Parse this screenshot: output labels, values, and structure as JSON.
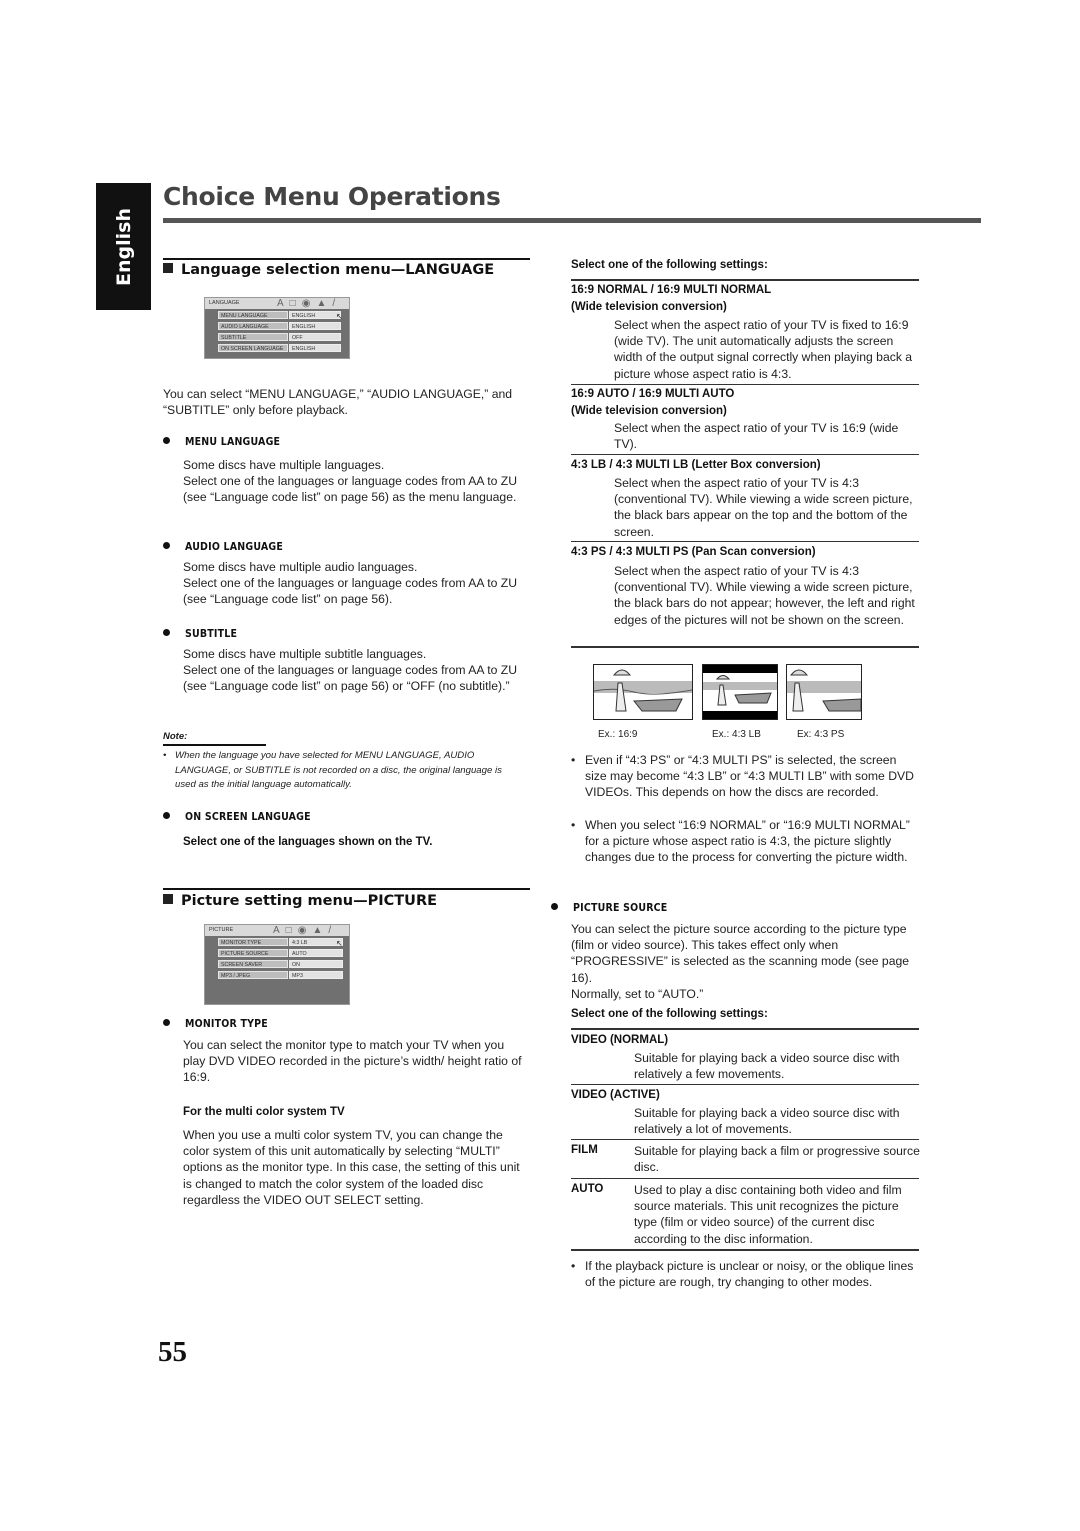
{
  "side_tab": "English",
  "page_title": "Choice Menu Operations",
  "page_number": "55",
  "language_section": {
    "heading": "Language selection menu—LANGUAGE",
    "osd": {
      "tab_label": "LANGUAGE",
      "icons": [
        "language-icon",
        "picture-icon",
        "audio-icon",
        "disc-icon",
        "wrench-icon"
      ],
      "rows": [
        {
          "label": "MENU LANGUAGE",
          "value": "ENGLISH"
        },
        {
          "label": "AUDIO LANGUAGE",
          "value": "ENGLISH"
        },
        {
          "label": "SUBTITLE",
          "value": "OFF"
        },
        {
          "label": "ON SCREEN LANGUAGE",
          "value": "ENGLISH"
        }
      ]
    },
    "intro": "You can select “MENU LANGUAGE,” “AUDIO LANGUAGE,” and “SUBTITLE” only before playback.",
    "items": [
      {
        "title": "MENU LANGUAGE",
        "text1": "Some discs have multiple languages.",
        "text2": "Select one of the languages or language codes from AA to ZU (see “Language code list” on page 56) as the menu language."
      },
      {
        "title": "AUDIO LANGUAGE",
        "text1": "Some discs have multiple audio languages.",
        "text2": "Select one of the languages or language codes from AA to ZU (see “Language code list” on page 56)."
      },
      {
        "title": "SUBTITLE",
        "text1": "Some discs have multiple subtitle languages.",
        "text2": "Select one of the languages or language codes from AA to ZU (see “Language code list” on page 56) or “OFF (no subtitle).”"
      }
    ],
    "note_label": "Note:",
    "note_text": "When the language you have selected for MENU LANGUAGE, AUDIO LANGUAGE, or SUBTITLE is not recorded on a disc, the original language is used as the initial language automatically.",
    "on_screen": {
      "title": "ON SCREEN LANGUAGE",
      "text": "Select one of the languages shown on the TV."
    }
  },
  "picture_section": {
    "heading": "Picture setting menu—PICTURE",
    "osd": {
      "tab_label": "PICTURE",
      "rows": [
        {
          "label": "MONITOR TYPE",
          "value": "4:3 LB"
        },
        {
          "label": "PICTURE SOURCE",
          "value": "AUTO"
        },
        {
          "label": "SCREEN SAVER",
          "value": "ON"
        },
        {
          "label": "MP3 / JPEG",
          "value": "MP3"
        }
      ]
    },
    "monitor_type": {
      "title": "MONITOR TYPE",
      "text": "You can select the monitor type to match your TV when you play DVD VIDEO recorded in the picture’s width/ height ratio of 16:9.",
      "multi_title": "For the multi color system TV",
      "multi_text": "When you use a multi color system TV, you can change the color system of this unit automatically by selecting “MULTI” options as the monitor type. In this case, the setting of this unit is changed to match the color system of the loaded disc regardless the VIDEO OUT SELECT setting."
    }
  },
  "right": {
    "select_label": "Select one of the following settings:",
    "monitor_options": [
      {
        "title": "16:9 NORMAL / 16:9  MULTI NORMAL",
        "subtitle": "(Wide television conversion)",
        "text": "Select when the aspect ratio of your TV is fixed to 16:9 (wide TV). The unit automatically adjusts the screen width of the output signal correctly when playing back a picture whose aspect ratio is 4:3."
      },
      {
        "title": "16:9 AUTO / 16:9 MULTI AUTO",
        "subtitle": "(Wide television conversion)",
        "text": "Select when the aspect ratio of your TV is 16:9 (wide TV)."
      },
      {
        "title": "4:3 LB / 4:3 MULTI LB (Letter Box conversion)",
        "subtitle": "",
        "text": "Select when the aspect ratio of your TV is 4:3 (conventional TV). While viewing a wide screen picture, the black bars appear on the top and the bottom of the screen."
      },
      {
        "title": "4:3 PS / 4:3 MULTI PS (Pan Scan conversion)",
        "subtitle": "",
        "text": "Select when the aspect ratio of your TV is 4:3 (conventional TV). While viewing a wide screen picture, the black bars do not appear; however, the left and right edges of the pictures will not be shown on the screen."
      }
    ],
    "examples": [
      "Ex.: 16:9",
      "Ex.: 4:3 LB",
      "Ex: 4:3 PS"
    ],
    "bullets": [
      "Even if “4:3 PS” or “4:3 MULTI PS” is selected, the screen size may become “4:3 LB” or “4:3 MULTI LB” with some DVD VIDEOs. This depends on how the discs are recorded.",
      "When you select “16:9 NORMAL” or “16:9 MULTI NORMAL” for a picture whose aspect ratio is 4:3, the picture slightly changes due to the process for converting the picture width."
    ],
    "picture_source": {
      "title": "PICTURE SOURCE",
      "text": "You can select the picture source according to the picture type (film or video source). This takes effect only when “PROGRESSIVE” is selected as the scanning mode (see page 16).",
      "normally": "Normally, set to “AUTO.”",
      "select_label": "Select one of the following settings:",
      "options": [
        {
          "label": "VIDEO (NORMAL)",
          "text": "Suitable for playing back a video source disc with relatively a few movements."
        },
        {
          "label": "VIDEO (ACTIVE)",
          "text": "Suitable for playing back a video source disc with relatively a lot of movements."
        },
        {
          "label": "FILM",
          "text": "Suitable for playing back a film or progressive source disc."
        },
        {
          "label": "AUTO",
          "text": "Used to play a disc containing both video and film source materials. This unit recognizes the picture type (film or video source) of the current disc according to the disc information."
        }
      ],
      "bullet": "If the playback picture is unclear or noisy, or the oblique lines of the picture are rough, try changing to other modes."
    }
  }
}
